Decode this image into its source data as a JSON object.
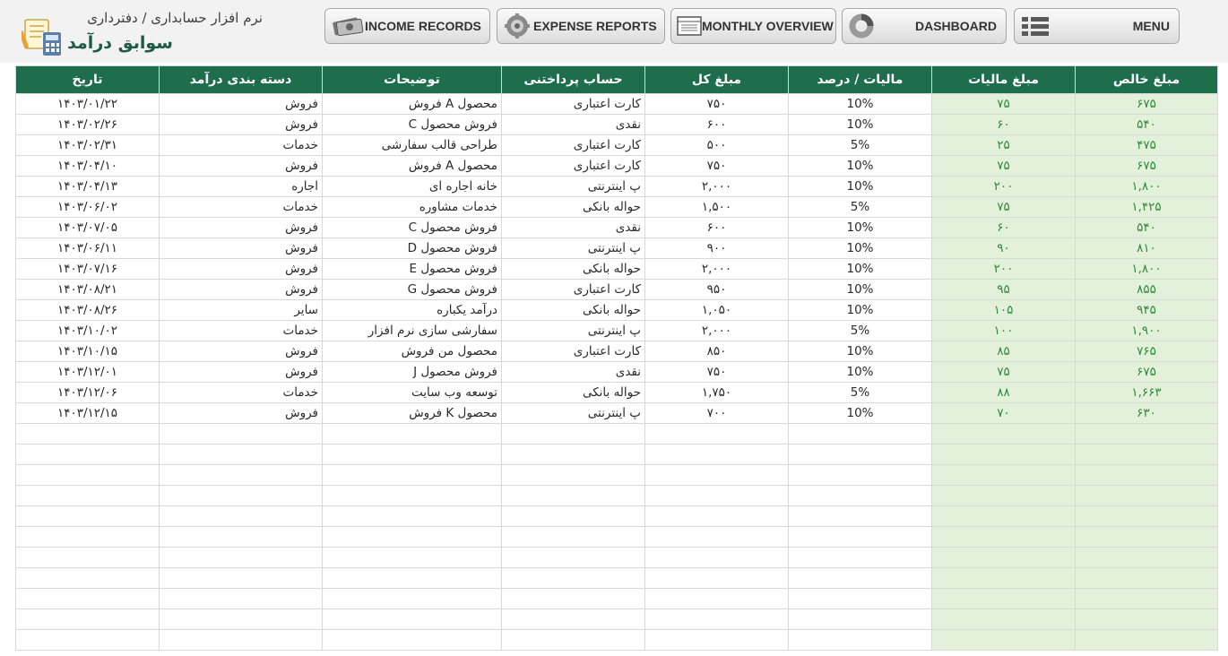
{
  "header": {
    "subtitle": "نرم افزار حسابداری / دفترداری",
    "title": "سوابق درآمد"
  },
  "nav": {
    "income": "INCOME RECORDS",
    "expense": "EXPENSE REPORTS",
    "monthly": "MONTHLY OVERVIEW",
    "dashboard": "DASHBOARD",
    "menu": "MENU"
  },
  "colors": {
    "header_bg": "#1e6e4e",
    "title": "#1e5a45",
    "highlight_bg": "#e3f1da",
    "highlight_text": "#2e8b3a"
  },
  "table": {
    "columns": [
      "تاریخ",
      "دسته بندی درآمد",
      "توضیحات",
      "حساب پرداختنی",
      "مبلغ کل",
      "مالیات / درصد",
      "مبلغ مالیات",
      "مبلغ خالص"
    ],
    "rows": [
      [
        "۱۴۰۳/۰۱/۲۲",
        "فروش",
        "محصول A فروش",
        "کارت اعتباری",
        "۷۵۰",
        "10%",
        "۷۵",
        "۶۷۵"
      ],
      [
        "۱۴۰۳/۰۲/۲۶",
        "فروش",
        "فروش محصول C",
        "نقدی",
        "۶۰۰",
        "10%",
        "۶۰",
        "۵۴۰"
      ],
      [
        "۱۴۰۳/۰۲/۳۱",
        "خدمات",
        "طراحی قالب سفارشی",
        "کارت اعتباری",
        "۵۰۰",
        "5%",
        "۲۵",
        "۴۷۵"
      ],
      [
        "۱۴۰۳/۰۴/۱۰",
        "فروش",
        "محصول A فروش",
        "کارت اعتباری",
        "۷۵۰",
        "10%",
        "۷۵",
        "۶۷۵"
      ],
      [
        "۱۴۰۳/۰۴/۱۳",
        "اجاره",
        "خانه اجاره ای",
        "پ اینترنتی",
        "۲,۰۰۰",
        "10%",
        "۲۰۰",
        "۱,۸۰۰"
      ],
      [
        "۱۴۰۳/۰۶/۰۲",
        "خدمات",
        "خدمات مشاوره",
        "حواله بانکی",
        "۱,۵۰۰",
        "5%",
        "۷۵",
        "۱,۴۲۵"
      ],
      [
        "۱۴۰۳/۰۷/۰۵",
        "فروش",
        "فروش محصول C",
        "نقدی",
        "۶۰۰",
        "10%",
        "۶۰",
        "۵۴۰"
      ],
      [
        "۱۴۰۳/۰۶/۱۱",
        "فروش",
        "فروش محصول D",
        "پ اینترنتی",
        "۹۰۰",
        "10%",
        "۹۰",
        "۸۱۰"
      ],
      [
        "۱۴۰۳/۰۷/۱۶",
        "فروش",
        "فروش محصول E",
        "حواله بانکی",
        "۲,۰۰۰",
        "10%",
        "۲۰۰",
        "۱,۸۰۰"
      ],
      [
        "۱۴۰۳/۰۸/۲۱",
        "فروش",
        "فروش محصول G",
        "کارت اعتباری",
        "۹۵۰",
        "10%",
        "۹۵",
        "۸۵۵"
      ],
      [
        "۱۴۰۳/۰۸/۲۶",
        "سایر",
        "درآمد یکباره",
        "حواله بانکی",
        "۱,۰۵۰",
        "10%",
        "۱۰۵",
        "۹۴۵"
      ],
      [
        "۱۴۰۳/۱۰/۰۲",
        "خدمات",
        "سفارشی سازی نرم افزار",
        "پ اینترنتی",
        "۲,۰۰۰",
        "5%",
        "۱۰۰",
        "۱,۹۰۰"
      ],
      [
        "۱۴۰۳/۱۰/۱۵",
        "فروش",
        "محصول من فروش",
        "کارت اعتباری",
        "۸۵۰",
        "10%",
        "۸۵",
        "۷۶۵"
      ],
      [
        "۱۴۰۳/۱۲/۰۱",
        "فروش",
        "فروش محصول J",
        "نقدی",
        "۷۵۰",
        "10%",
        "۷۵",
        "۶۷۵"
      ],
      [
        "۱۴۰۳/۱۲/۰۶",
        "خدمات",
        "توسعه وب سایت",
        "حواله بانکی",
        "۱,۷۵۰",
        "5%",
        "۸۸",
        "۱,۶۶۳"
      ],
      [
        "۱۴۰۳/۱۲/۱۵",
        "فروش",
        "محصول K فروش",
        "پ اینترنتی",
        "۷۰۰",
        "10%",
        "۷۰",
        "۶۳۰"
      ]
    ]
  }
}
